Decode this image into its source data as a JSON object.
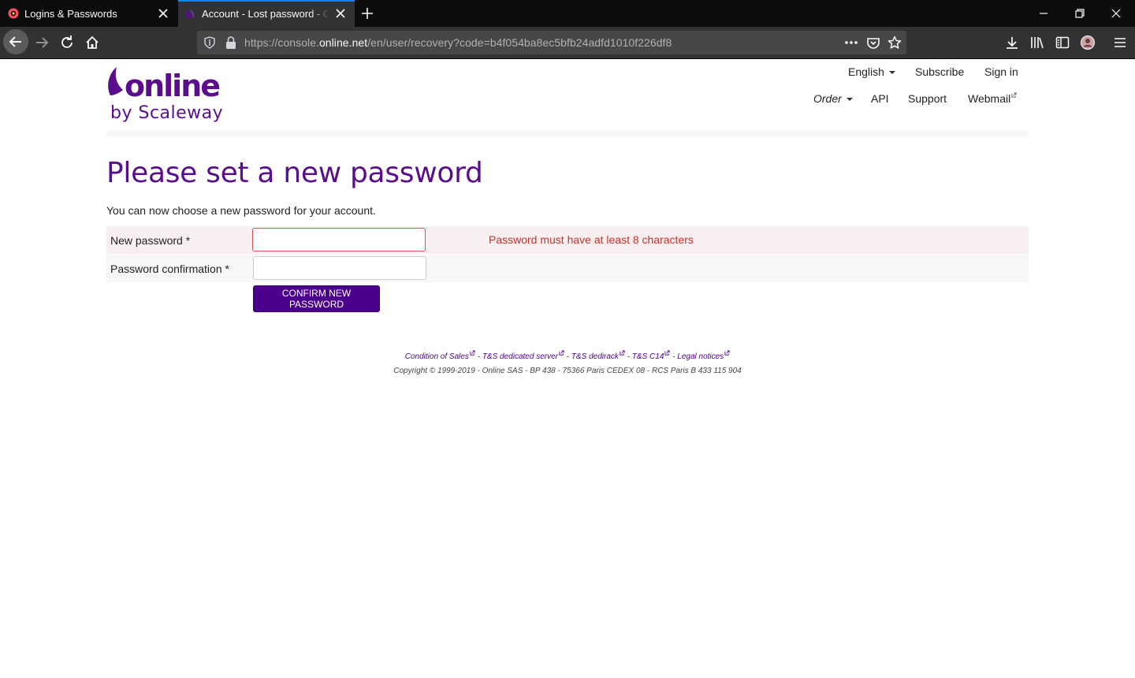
{
  "browser": {
    "tabs": [
      {
        "title": "Logins & Passwords",
        "active": false
      },
      {
        "title": "Account - Lost password - Online",
        "active": true
      }
    ],
    "url_prefix": "https://console.",
    "url_domain": "online.net",
    "url_path": "/en/user/recovery?code=b4f054ba8ec5bfb24adfd1010f226df8",
    "icons": [
      "back-icon",
      "forward-icon",
      "reload-icon",
      "home-icon",
      "shield-icon",
      "lock-icon",
      "more-icon",
      "pocket-icon",
      "star-icon",
      "download-icon",
      "library-icon",
      "sidebar-icon",
      "account-icon",
      "menu-icon"
    ],
    "accent": "#0a84ff"
  },
  "site": {
    "logo_word": "online",
    "logo_sub": "by Scaleway",
    "brand_color": "#5a0e8c",
    "topnav": {
      "language": "English",
      "subscribe": "Subscribe",
      "signin": "Sign in"
    },
    "subnav": {
      "order": "Order",
      "api": "API",
      "support": "Support",
      "webmail": "Webmail"
    }
  },
  "main": {
    "heading": "Please set a new password",
    "intro": "You can now choose a new password for your account.",
    "form": {
      "new_password_label": "New password *",
      "new_password_value": "",
      "new_password_error": "Password must have at least 8 characters",
      "confirm_label": "Password confirmation *",
      "confirm_value": "",
      "submit_label": "CONFIRM NEW PASSWORD"
    },
    "error_color": "#c9302c"
  },
  "footer": {
    "links": [
      "Condition of Sales",
      "T&S dedicated server",
      "T&S dedirack",
      "T&S C14",
      "Legal notices"
    ],
    "separator": " - ",
    "copyright": "Copyright © 1999-2019 - Online SAS - BP 438 - 75366 Paris CEDEX 08 - RCS Paris B 433 115 904"
  }
}
